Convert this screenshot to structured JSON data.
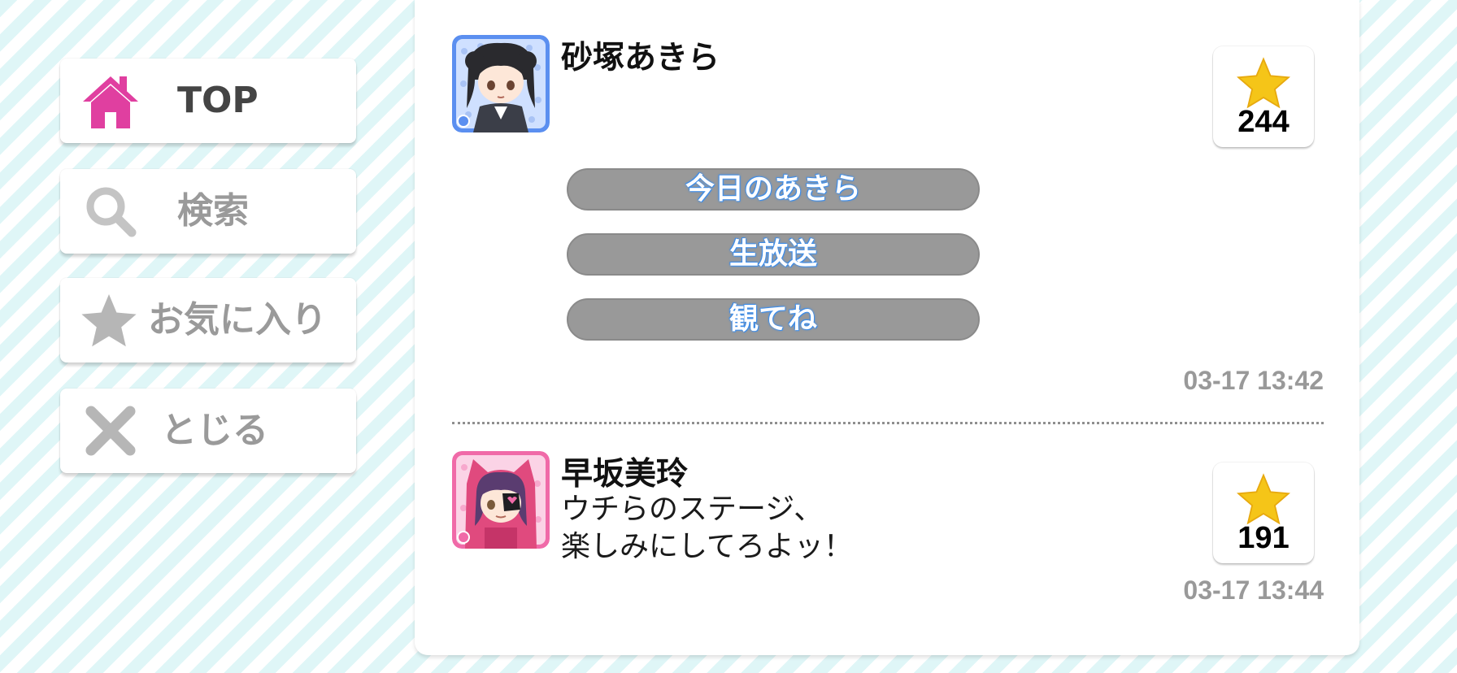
{
  "nav": {
    "items": [
      {
        "label": "TOP",
        "icon": "home-icon",
        "color": "#e03fa0",
        "active": true
      },
      {
        "label": "検索",
        "icon": "search-icon"
      },
      {
        "label": "お気に入り",
        "icon": "star-icon"
      },
      {
        "label": "とじる",
        "icon": "close-icon"
      }
    ]
  },
  "posts": [
    {
      "user_name": "砂塚あきら",
      "avatar_icon": "character-avatar-icon",
      "avatar_frame_color": "#5b8ff0",
      "text_buttons": [
        "今日のあきら",
        "生放送",
        "観てね"
      ],
      "fav_count": "244",
      "timestamp": "03-17 13:42"
    },
    {
      "user_name": "早坂美玲",
      "avatar_icon": "character-avatar-icon",
      "avatar_frame_color": "#f06aa8",
      "text_lines": [
        "ウチらのステージ、",
        "楽しみにしてろよッ！"
      ],
      "fav_count": "191",
      "timestamp": "03-17 13:44"
    }
  ],
  "colors": {
    "accent_pink": "#e03fa0",
    "inactive_gray": "#9a9a9a",
    "star_gold": "#f5c518",
    "pill_gray": "#999999",
    "pill_text_glow": "#3f8de8",
    "stripe": "#dff6f7"
  }
}
